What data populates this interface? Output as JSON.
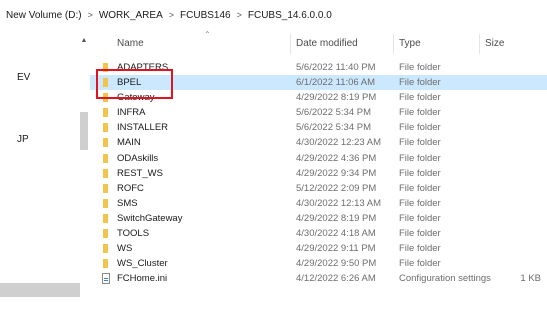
{
  "breadcrumb": {
    "items": [
      "New Volume (D:)",
      "WORK_AREA",
      "FCUBS146",
      "FCUBS_14.6.0.0.0"
    ],
    "separator": ">"
  },
  "nav_pane": {
    "labels": [
      "EV",
      "JP"
    ]
  },
  "columns": {
    "name": "Name",
    "date": "Date modified",
    "type": "Type",
    "size": "Size"
  },
  "rows": [
    {
      "name": "ADAPTERS",
      "date": "5/6/2022 11:40 PM",
      "type": "File folder",
      "size": "",
      "kind": "folder"
    },
    {
      "name": "BPEL",
      "date": "6/1/2022 11:06 AM",
      "type": "File folder",
      "size": "",
      "kind": "folder",
      "selected": true
    },
    {
      "name": "Gateway",
      "date": "4/29/2022 8:19 PM",
      "type": "File folder",
      "size": "",
      "kind": "folder"
    },
    {
      "name": "INFRA",
      "date": "5/6/2022 5:34 PM",
      "type": "File folder",
      "size": "",
      "kind": "folder"
    },
    {
      "name": "INSTALLER",
      "date": "5/6/2022 5:34 PM",
      "type": "File folder",
      "size": "",
      "kind": "folder"
    },
    {
      "name": "MAIN",
      "date": "4/30/2022 12:23 AM",
      "type": "File folder",
      "size": "",
      "kind": "folder"
    },
    {
      "name": "ODAskills",
      "date": "4/29/2022 4:36 PM",
      "type": "File folder",
      "size": "",
      "kind": "folder"
    },
    {
      "name": "REST_WS",
      "date": "4/29/2022 9:34 PM",
      "type": "File folder",
      "size": "",
      "kind": "folder"
    },
    {
      "name": "ROFC",
      "date": "5/12/2022 2:09 PM",
      "type": "File folder",
      "size": "",
      "kind": "folder"
    },
    {
      "name": "SMS",
      "date": "4/30/2022 12:13 AM",
      "type": "File folder",
      "size": "",
      "kind": "folder"
    },
    {
      "name": "SwitchGateway",
      "date": "4/29/2022 8:19 PM",
      "type": "File folder",
      "size": "",
      "kind": "folder"
    },
    {
      "name": "TOOLS",
      "date": "4/30/2022 4:18 AM",
      "type": "File folder",
      "size": "",
      "kind": "folder"
    },
    {
      "name": "WS",
      "date": "4/29/2022 9:11 PM",
      "type": "File folder",
      "size": "",
      "kind": "folder"
    },
    {
      "name": "WS_Cluster",
      "date": "4/29/2022 9:50 PM",
      "type": "File folder",
      "size": "",
      "kind": "folder"
    },
    {
      "name": "FCHome.ini",
      "date": "4/12/2022 6:26 AM",
      "type": "Configuration settings",
      "size": "1 KB",
      "kind": "file"
    }
  ],
  "colors": {
    "folder": "#f2c44b",
    "selection": "#cce8ff",
    "highlight_border": "#e0141e"
  }
}
